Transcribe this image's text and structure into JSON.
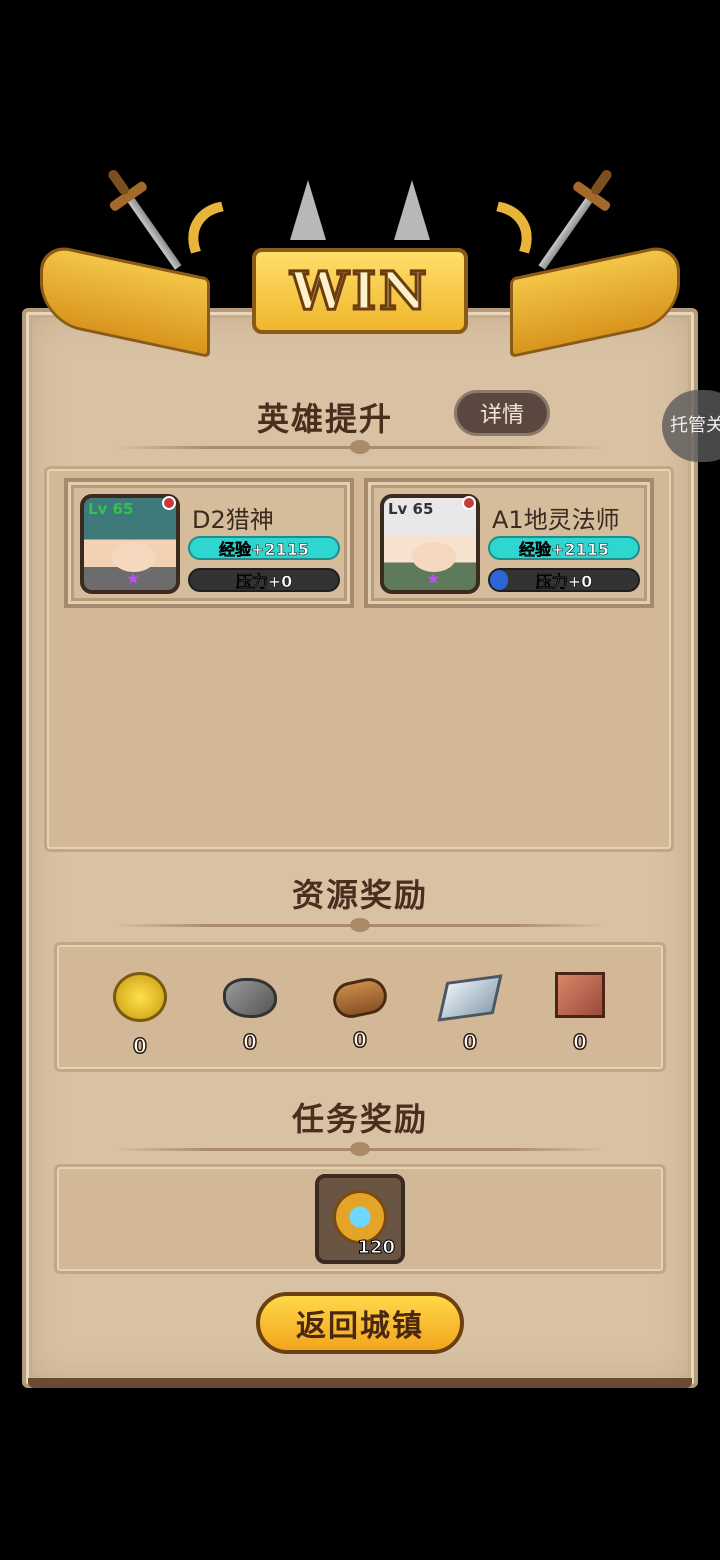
{
  "banner": {
    "title": "WIN"
  },
  "hero_section": {
    "title": "英雄提升",
    "detail_button": "详情"
  },
  "heroes": [
    {
      "name": "D2猎神",
      "level": "Lv 65",
      "exp": "经验+2115",
      "pressure": "压力+0",
      "pressure_fill": 0
    },
    {
      "name": "A1地灵法师",
      "level": "Lv 65",
      "exp": "经验+2115",
      "pressure": "压力+0",
      "pressure_fill": 0.12
    }
  ],
  "resource_section": {
    "title": "资源奖励",
    "items": [
      {
        "icon": "gold-coin-icon",
        "count": "0"
      },
      {
        "icon": "stone-icon",
        "count": "0"
      },
      {
        "icon": "wood-log-icon",
        "count": "0"
      },
      {
        "icon": "iron-icon",
        "count": "0"
      },
      {
        "icon": "cloth-icon",
        "count": "0"
      }
    ]
  },
  "quest_section": {
    "title": "任务奖励",
    "reward": {
      "icon": "star-medal-icon",
      "count": "120"
    }
  },
  "return_button": "返回城镇",
  "auto_button": "托管关"
}
